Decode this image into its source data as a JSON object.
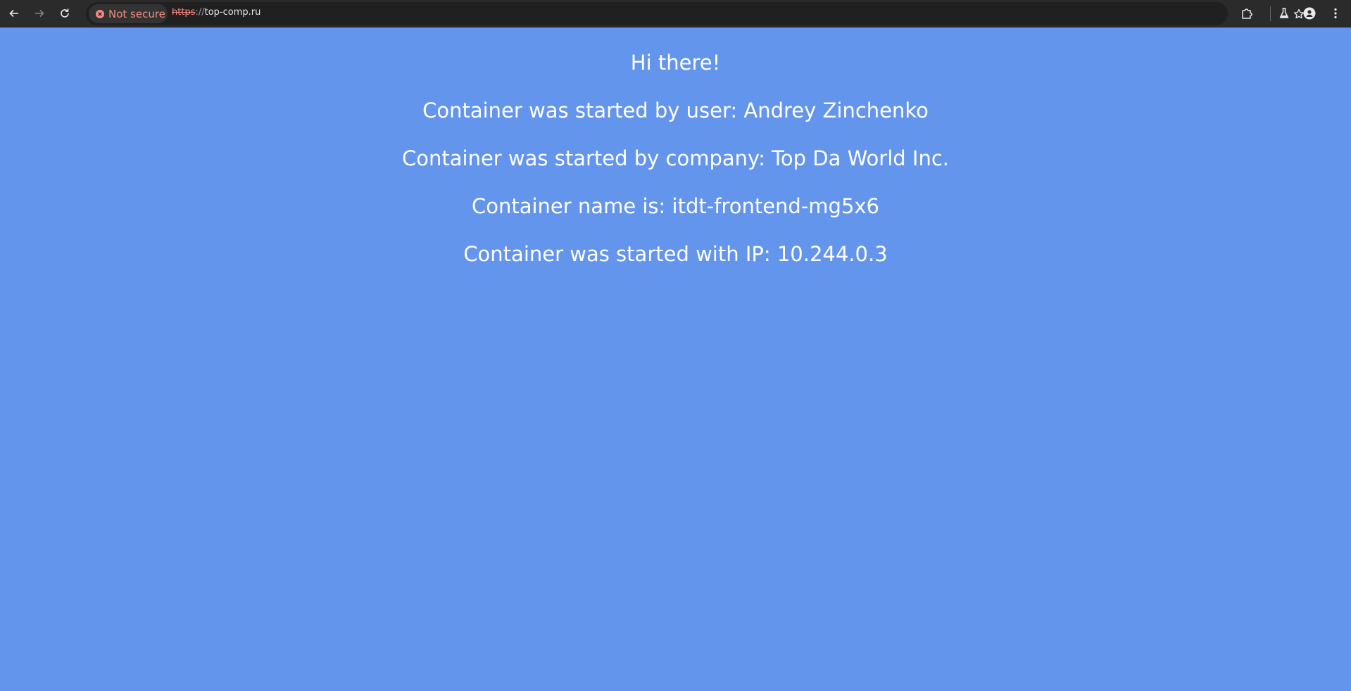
{
  "browser": {
    "security_label": "Not secure",
    "url_scheme": "https",
    "url_separator": "://",
    "url_host": "top-comp.ru"
  },
  "page": {
    "greeting": "Hi there!",
    "user_line": "Container was started by user: Andrey Zinchenko",
    "company_line": "Container was started by company: Top Da World Inc.",
    "name_line": "Container name is: itdt-frontend-mg5x6",
    "ip_line": "Container was started with IP: 10.244.0.3"
  },
  "colors": {
    "page_background": "#6495ed",
    "toolbar_background": "#2b2b2b",
    "warning": "#f28b82",
    "text": "#ffffff"
  }
}
